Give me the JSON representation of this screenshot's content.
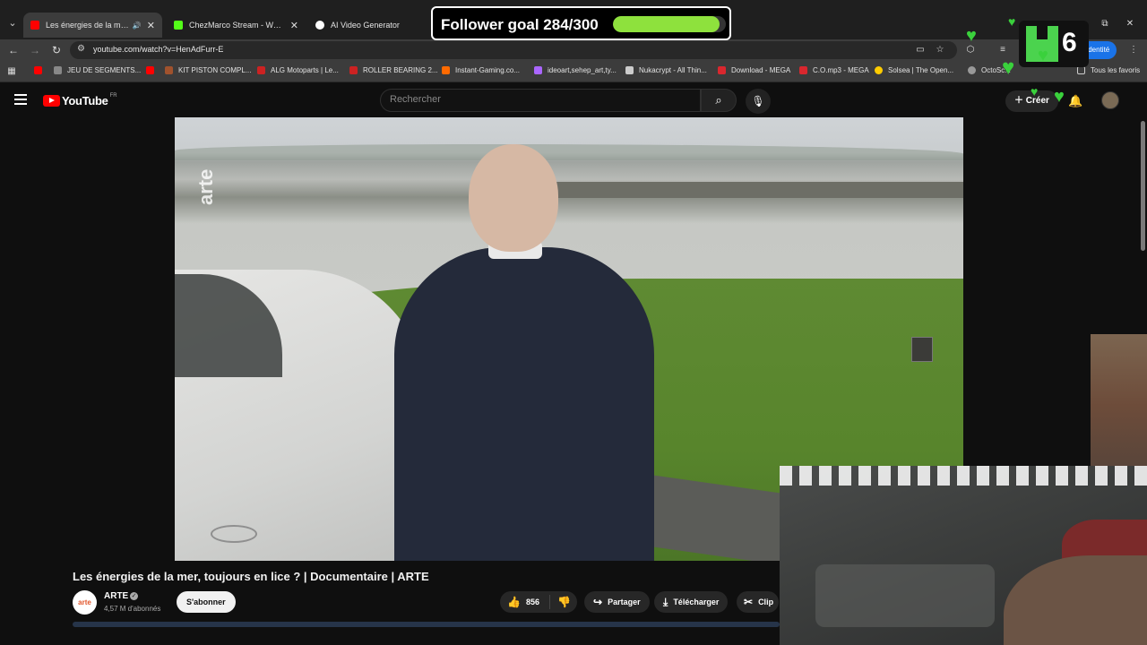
{
  "browser": {
    "tabs": [
      {
        "label": "Les énergies de la mer, touj",
        "active": true,
        "icon": "youtube-icon",
        "color": "#ff0000"
      },
      {
        "label": "ChezMarco Stream - Watch Live",
        "active": false,
        "icon": "kick-icon",
        "color": "#53fc18"
      },
      {
        "label": "AI Video Generator",
        "active": false,
        "icon": "infinity-icon",
        "color": "#ffffff"
      }
    ],
    "url": "youtube.com/watch?v=HenAdFurr-E",
    "identity_label": "Identité",
    "bookmarks": [
      {
        "label": "",
        "icon": "youtube-icon",
        "color": "#ff0000"
      },
      {
        "label": "JEU DE SEGMENTS...",
        "icon": "shop-icon",
        "color": "#888888"
      },
      {
        "label": "",
        "icon": "youtube-icon",
        "color": "#ff0000"
      },
      {
        "label": "KIT PISTON COMPL...",
        "icon": "site-icon",
        "color": "#a0522d"
      },
      {
        "label": "ALG Motoparts | Le...",
        "icon": "site-icon",
        "color": "#cc2222"
      },
      {
        "label": "ROLLER BEARING 2...",
        "icon": "site-icon",
        "color": "#cc2222"
      },
      {
        "label": "Instant-Gaming.co...",
        "icon": "site-icon",
        "color": "#ff6a00"
      },
      {
        "label": "ideoart,sehep_art,ty...",
        "icon": "site-icon",
        "color": "#aa66ff"
      },
      {
        "label": "Nukacrypt - All Thin...",
        "icon": "site-icon",
        "color": "#cccccc"
      },
      {
        "label": "Download - MEGA",
        "icon": "mega-icon",
        "color": "#d9272e"
      },
      {
        "label": "C.O.mp3 - MEGA",
        "icon": "mega-icon",
        "color": "#d9272e"
      },
      {
        "label": "Solsea | The Open...",
        "icon": "site-icon",
        "color": "#ffcc00"
      },
      {
        "label": "OctoSc...",
        "icon": "site-icon",
        "color": "#999999"
      }
    ],
    "all_bookmarks_label": "Tous les favoris"
  },
  "youtube": {
    "logo_text": "YouTube",
    "logo_region": "FR",
    "search_placeholder": "Rechercher",
    "create_label": "Créer",
    "video": {
      "title": "Les énergies de la mer, toujours en lice ? | Documentaire | ARTE",
      "channel": "ARTE",
      "channel_avatar_text": "arte",
      "subscribers": "4,57 M d'abonnés",
      "subscribe_label": "S'abonner",
      "likes": "856",
      "share_label": "Partager",
      "download_label": "Télécharger",
      "clip_label": "Clip",
      "watermark": "arte"
    }
  },
  "overlay": {
    "follower_goal_text": "Follower goal 284/300",
    "follower_current": 284,
    "follower_target": 300,
    "follower_fraction": 0.947,
    "counter_value": "6",
    "accent": "#8ee13d"
  }
}
